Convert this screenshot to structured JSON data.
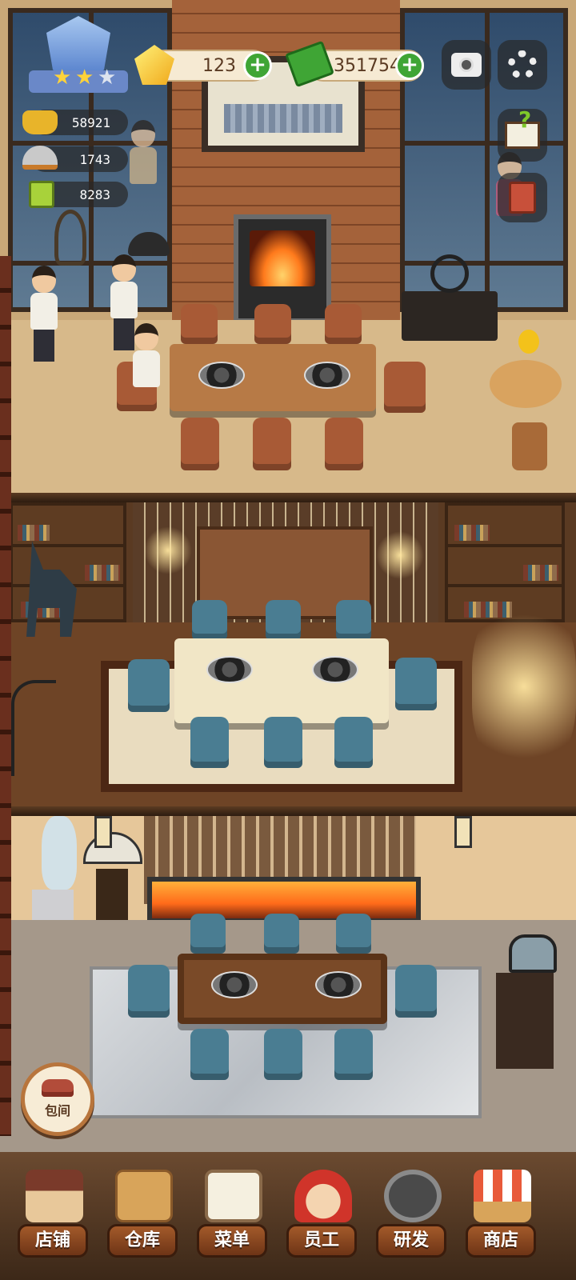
{
  "hud": {
    "level_badge": {
      "stars": 2
    },
    "gems": {
      "value": "123",
      "icon": "yellow-gem-icon"
    },
    "cash": {
      "value": "351754",
      "icon": "cash-stack-icon"
    },
    "stats": [
      {
        "icon": "gold-ingot-icon",
        "value": "58921"
      },
      {
        "icon": "serving-dish-icon",
        "value": "1743"
      },
      {
        "icon": "recipe-book-icon",
        "value": "8283"
      }
    ],
    "buttons": {
      "camera": "camera-icon",
      "settings": "gear-icon",
      "help": "help-book-icon",
      "notes": "notebook-icon"
    }
  },
  "room_button": {
    "label": "包间",
    "icon": "sofa-icon"
  },
  "bottom_nav": [
    {
      "label": "店铺",
      "icon": "store-building-icon"
    },
    {
      "label": "仓库",
      "icon": "warehouse-boxes-icon"
    },
    {
      "label": "菜单",
      "icon": "menu-clipboard-icon"
    },
    {
      "label": "员工",
      "icon": "staff-chef-icon"
    },
    {
      "label": "研发",
      "icon": "wok-research-icon"
    },
    {
      "label": "商店",
      "icon": "shop-stall-icon"
    }
  ],
  "colors": {
    "accent_green": "#3fa535",
    "nav_label": "#8e4a20",
    "pill_bg": "#f6ead3"
  }
}
